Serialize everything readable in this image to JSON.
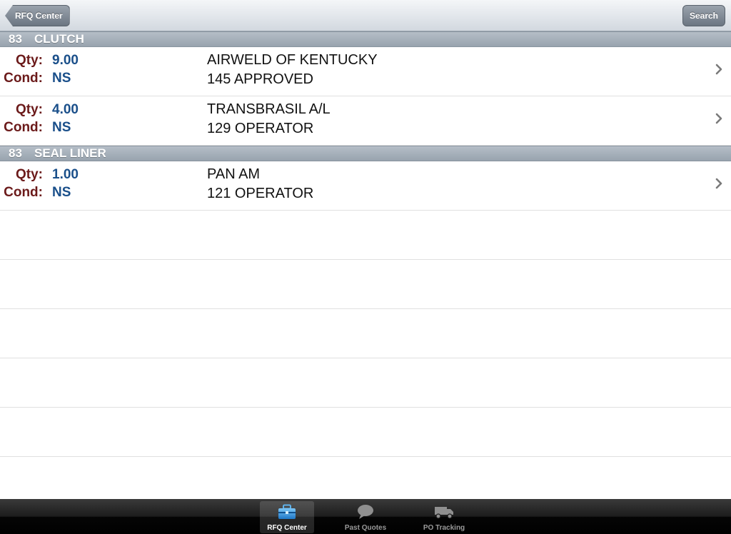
{
  "navbar": {
    "back_label": "RFQ Center",
    "search_label": "Search"
  },
  "sections": [
    {
      "number": "83",
      "title": "CLUTCH",
      "rows": [
        {
          "qty_label": "Qty:",
          "qty": "9.00",
          "cond_label": "Cond:",
          "cond": "NS",
          "company": "AIRWELD OF KENTUCKY",
          "cert": "145 APPROVED"
        },
        {
          "qty_label": "Qty:",
          "qty": "4.00",
          "cond_label": "Cond:",
          "cond": "NS",
          "company": "TRANSBRASIL A/L",
          "cert": "129 OPERATOR"
        }
      ]
    },
    {
      "number": "83",
      "title": "SEAL LINER",
      "rows": [
        {
          "qty_label": "Qty:",
          "qty": "1.00",
          "cond_label": "Cond:",
          "cond": "NS",
          "company": "PAN AM",
          "cert": "121 OPERATOR"
        }
      ]
    }
  ],
  "tabbar": {
    "tabs": [
      {
        "label": "RFQ Center",
        "icon": "toolbox-icon",
        "active": true
      },
      {
        "label": "Past Quotes",
        "icon": "speech-bubble-icon",
        "active": false
      },
      {
        "label": "PO Tracking",
        "icon": "truck-icon",
        "active": false
      }
    ]
  },
  "colors": {
    "label": "#6b1a1a",
    "value": "#1a4f8a",
    "section_header": "#a7b1bb"
  }
}
